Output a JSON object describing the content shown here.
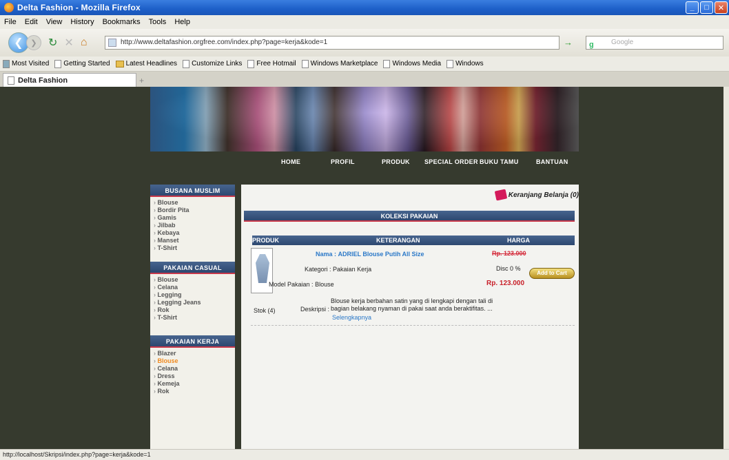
{
  "window": {
    "title": "Delta Fashion - Mozilla Firefox"
  },
  "menu": [
    "File",
    "Edit",
    "View",
    "History",
    "Bookmarks",
    "Tools",
    "Help"
  ],
  "address": {
    "url": "http://www.deltafashion.orgfree.com/index.php?page=kerja&kode=1",
    "search_placeholder": "Google"
  },
  "bookmarks": [
    "Most Visited",
    "Getting Started",
    "Latest Headlines",
    "Customize Links",
    "Free Hotmail",
    "Windows Marketplace",
    "Windows Media",
    "Windows"
  ],
  "tab": {
    "title": "Delta Fashion",
    "new_tab": "+"
  },
  "status": {
    "text": "http://localhost/Skripsi/index.php?page=kerja&kode=1"
  },
  "site": {
    "nav": [
      "HOME",
      "PROFIL",
      "PRODUK",
      "SPECIAL ORDER",
      "BUKU TAMU",
      "BANTUAN"
    ],
    "sidebar": [
      {
        "title": "BUSANA MUSLIM",
        "items": [
          "Blouse",
          "Bordir Pita",
          "Gamis",
          "Jilbab",
          "Kebaya",
          "Manset",
          "T-Shirt"
        ]
      },
      {
        "title": "PAKAIAN CASUAL",
        "items": [
          "Blouse",
          "Celana",
          "Legging",
          "Legging Jeans",
          "Rok",
          "T-Shirt"
        ]
      },
      {
        "title": "PAKAIAN KERJA",
        "items": [
          "Blazer",
          "Blouse",
          "Celana",
          "Dress",
          "Kemeja",
          "Rok"
        ],
        "active_index": 1
      }
    ],
    "cart": "Keranjang Belanja (0)",
    "collection_title": "KOLEKSI PAKAIAN",
    "table": {
      "headers": [
        "PRODUK",
        "KETERANGAN",
        "HARGA"
      ]
    },
    "product": {
      "name_label": "Nama :",
      "name": "ADRIEL Blouse Putih All Size",
      "old_price": "Rp. 123.000",
      "category_label": "Kategori :",
      "category": "Pakaian Kerja",
      "disc": "Disc 0 %",
      "model_label": "Model Pakaian :",
      "model": "Blouse",
      "price": "Rp. 123.000",
      "add_to_cart": "Add to Cart",
      "stock": "Stok (4)",
      "desc_label": "Deskripsi :",
      "desc": "Blouse kerja berbahan satin yang di lengkapi dengan tali di bagian belakang nyaman di pakai saat anda beraktifitas. ...",
      "more": "Selengkapnya"
    }
  },
  "colors": {
    "page_bg": "#363a2e",
    "section_header": "#2d4870",
    "accent_red": "#c8384a",
    "link_blue": "#2a78c8",
    "active_orange": "#f08a20"
  }
}
